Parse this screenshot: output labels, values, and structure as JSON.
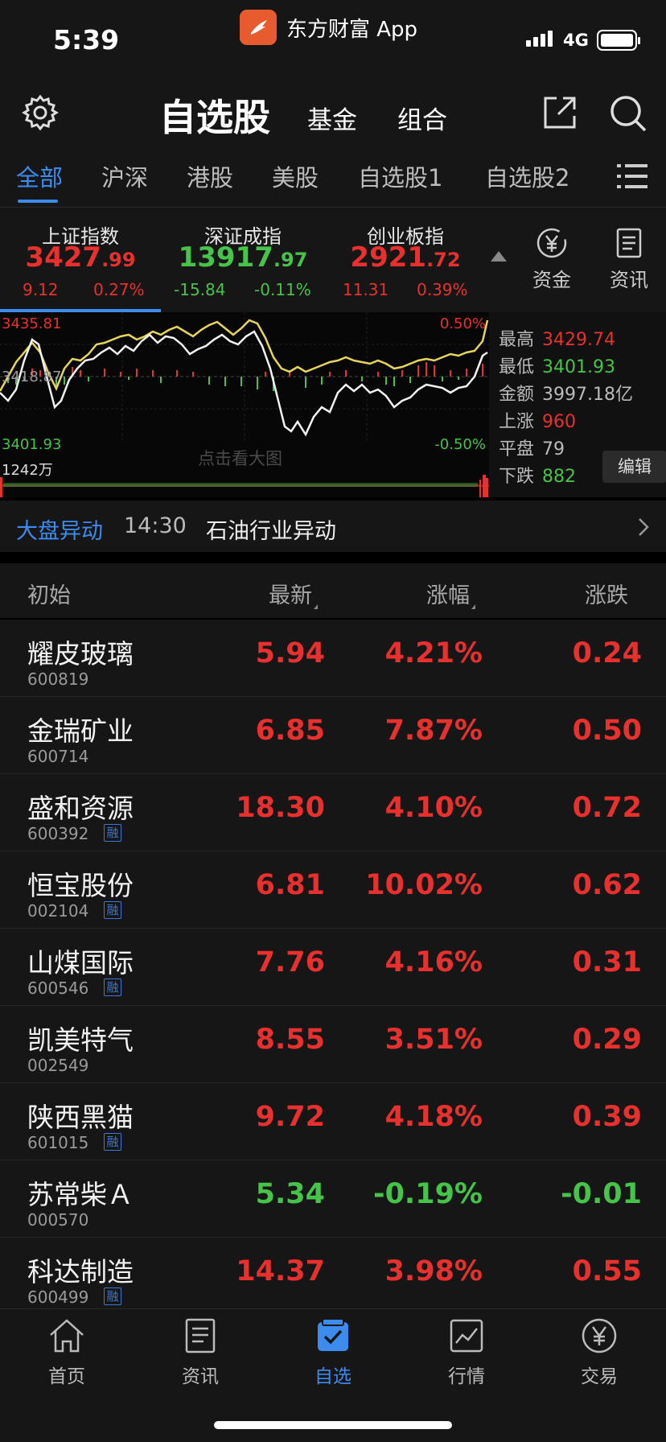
{
  "status": {
    "time": "5:39",
    "app_label": "东方财富 App",
    "network": "4G"
  },
  "header": {
    "title": "自选股",
    "tab_fund": "基金",
    "tab_portfolio": "组合"
  },
  "tabs": [
    {
      "label": "全部"
    },
    {
      "label": "沪深"
    },
    {
      "label": "港股"
    },
    {
      "label": "美股"
    },
    {
      "label": "自选股1"
    },
    {
      "label": "自选股2"
    }
  ],
  "indices": [
    {
      "name": "上证指数",
      "value_main": "3427",
      "value_dec": ".99",
      "change": "9.12",
      "pct": "0.27%",
      "color": "#e8302e"
    },
    {
      "name": "深证成指",
      "value_main": "13917",
      "value_dec": ".97",
      "change": "-15.84",
      "pct": "-0.11%",
      "color": "#46c349"
    },
    {
      "name": "创业板指",
      "value_main": "2921",
      "value_dec": ".72",
      "change": "11.31",
      "pct": "0.39%",
      "color": "#e8302e"
    }
  ],
  "side_buttons": {
    "funds": "资金",
    "news": "资讯"
  },
  "chart": {
    "high_label": "3435.81",
    "mid_label": "3418.87",
    "low_label": "3401.93",
    "pct_high": "0.50%",
    "pct_low": "-0.50%",
    "volume_label": "1242万",
    "hint": "点击看大图"
  },
  "stats": {
    "high_label": "最高",
    "high": "3429.74",
    "low_label": "最低",
    "low": "3401.93",
    "amount_label": "金额",
    "amount": "3997.18亿",
    "up_label": "上涨",
    "up": "960",
    "flat_label": "平盘",
    "flat": "79",
    "down_label": "下跌",
    "down": "882",
    "edit": "编辑"
  },
  "alert": {
    "tag": "大盘异动",
    "time": "14:30",
    "text": "石油行业异动"
  },
  "table": {
    "headers": {
      "name": "初始",
      "latest": "最新",
      "pct": "涨幅",
      "change": "涨跌"
    },
    "rows": [
      {
        "name": "耀皮玻璃",
        "code": "600819",
        "margin": false,
        "price": "5.94",
        "pct": "4.21%",
        "chg": "0.24",
        "up": true
      },
      {
        "name": "金瑞矿业",
        "code": "600714",
        "margin": false,
        "price": "6.85",
        "pct": "7.87%",
        "chg": "0.50",
        "up": true
      },
      {
        "name": "盛和资源",
        "code": "600392",
        "margin": true,
        "price": "18.30",
        "pct": "4.10%",
        "chg": "0.72",
        "up": true
      },
      {
        "name": "恒宝股份",
        "code": "002104",
        "margin": true,
        "price": "6.81",
        "pct": "10.02%",
        "chg": "0.62",
        "up": true
      },
      {
        "name": "山煤国际",
        "code": "600546",
        "margin": true,
        "price": "7.76",
        "pct": "4.16%",
        "chg": "0.31",
        "up": true
      },
      {
        "name": "凯美特气",
        "code": "002549",
        "margin": false,
        "price": "8.55",
        "pct": "3.51%",
        "chg": "0.29",
        "up": true
      },
      {
        "name": "陕西黑猫",
        "code": "601015",
        "margin": true,
        "price": "9.72",
        "pct": "4.18%",
        "chg": "0.39",
        "up": true
      },
      {
        "name": "苏常柴Ａ",
        "code": "000570",
        "margin": false,
        "price": "5.34",
        "pct": "-0.19%",
        "chg": "-0.01",
        "up": false
      },
      {
        "name": "科达制造",
        "code": "600499",
        "margin": true,
        "price": "14.37",
        "pct": "3.98%",
        "chg": "0.55",
        "up": true
      }
    ],
    "margin_badge": "融"
  },
  "bottom_nav": [
    {
      "label": "首页",
      "icon": "home-icon"
    },
    {
      "label": "资讯",
      "icon": "news-icon"
    },
    {
      "label": "自选",
      "icon": "watchlist-icon"
    },
    {
      "label": "行情",
      "icon": "market-icon"
    },
    {
      "label": "交易",
      "icon": "trade-icon"
    }
  ],
  "colors": {
    "up": "#e8302e",
    "down": "#46c349",
    "accent": "#3c8cf0"
  }
}
